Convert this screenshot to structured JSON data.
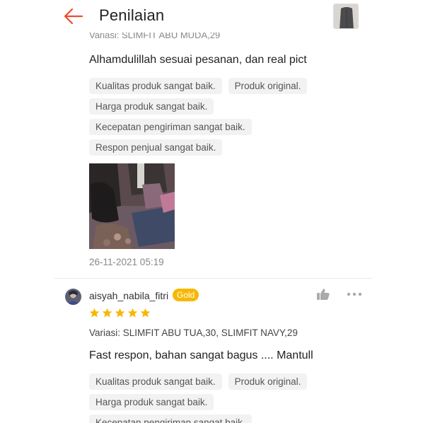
{
  "header": {
    "title": "Penilaian",
    "back_icon": "arrow-left-icon",
    "accent_color": "#ee4d2d"
  },
  "previous_review": {
    "variant_cut": "Variasi: SLIMFIT ABU MUDA,29",
    "text": "Alhamdulillah sesuai pesanan, dan real pict",
    "tags": [
      "Kualitas produk sangat baik.",
      "Produk original.",
      "Harga produk sangat baik.",
      "Kecepatan pengiriman sangat baik.",
      "Respon penjual sangat baik."
    ],
    "date": "26-11-2021 05:19"
  },
  "review": {
    "username": "aisyah_nabila_fitri",
    "badge": "Gold",
    "rating": 5,
    "variant": "Variasi: SLIMFIT ABU TUA,30, SLIMFIT NAVY,29",
    "text": "Fast respon, bahan sangat bagus .... Mantull",
    "tags": [
      "Kualitas produk sangat baik.",
      "Produk original.",
      "Harga produk sangat baik.",
      "Kecepatan pengiriman sangat baik."
    ],
    "icons": {
      "like": "thumbs-up-icon",
      "more": "more-dots-icon",
      "star": "star-icon"
    },
    "star_color": "#f6b800"
  }
}
